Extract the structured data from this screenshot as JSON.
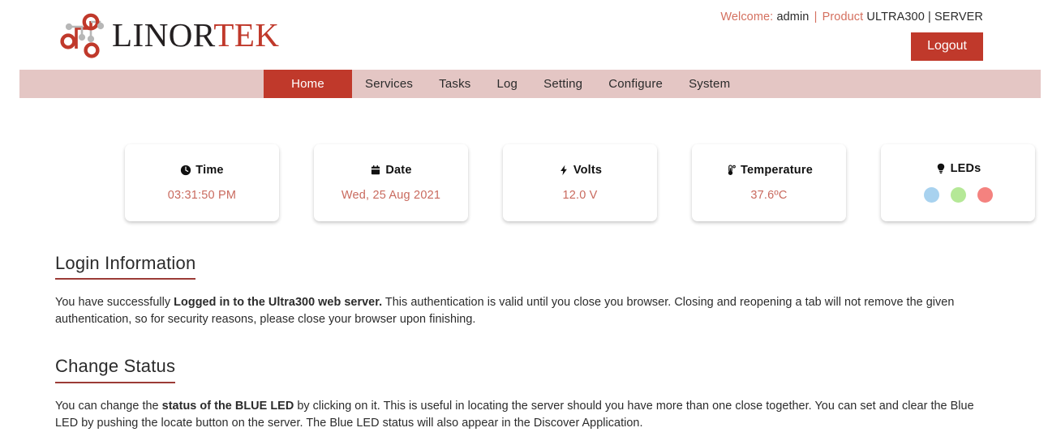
{
  "header": {
    "logo": {
      "icon": "circuit-network-icon",
      "text_dark": "LINOR",
      "text_red": "TEK"
    },
    "welcome": {
      "welcome_label": "Welcome:",
      "user": "admin",
      "separator": "|",
      "product_label": "Product",
      "product_value": "ULTRA300",
      "role": "SERVER"
    },
    "logout_label": "Logout"
  },
  "nav": {
    "items": [
      {
        "label": "Home",
        "active": true
      },
      {
        "label": "Services",
        "active": false
      },
      {
        "label": "Tasks",
        "active": false
      },
      {
        "label": "Log",
        "active": false
      },
      {
        "label": "Setting",
        "active": false
      },
      {
        "label": "Configure",
        "active": false
      },
      {
        "label": "System",
        "active": false
      }
    ]
  },
  "cards": [
    {
      "icon": "clock-icon",
      "title": "Time",
      "value": "03:31:50 PM"
    },
    {
      "icon": "calendar-icon",
      "title": "Date",
      "value": "Wed, 25 Aug 2021"
    },
    {
      "icon": "bolt-icon",
      "title": "Volts",
      "value": "12.0 V"
    },
    {
      "icon": "thermometer-icon",
      "title": "Temperature",
      "value": "37.6ºC"
    },
    {
      "icon": "lightbulb-icon",
      "title": "LEDs",
      "value": ""
    }
  ],
  "leds": [
    {
      "name": "blue-led",
      "color": "#a8d2ef"
    },
    {
      "name": "green-led",
      "color": "#b5e897"
    },
    {
      "name": "red-led",
      "color": "#f4827f"
    }
  ],
  "sections": {
    "login": {
      "heading": "Login Information",
      "p1_a": "You have successfully ",
      "p1_b": "Logged in to the Ultra300 web server.",
      "p1_c": " This authentication is valid until you close you browser. Closing and reopening a tab will not remove the given authentication, so for security reasons, please close your browser upon finishing."
    },
    "status": {
      "heading": "Change Status",
      "p1_a": "You can change the ",
      "p1_b": "status of the BLUE LED",
      "p1_c": " by clicking on it. This is useful in locating the server should you have more than one close together. You can set and clear the Blue LED by pushing the locate button on the server. The Blue LED status will also appear in the Discover Application."
    }
  },
  "colors": {
    "brand_red": "#c0392b",
    "nav_bg": "#e4c6c4",
    "accent_text": "#c96a5e",
    "heading_rule": "#9b3b36"
  }
}
